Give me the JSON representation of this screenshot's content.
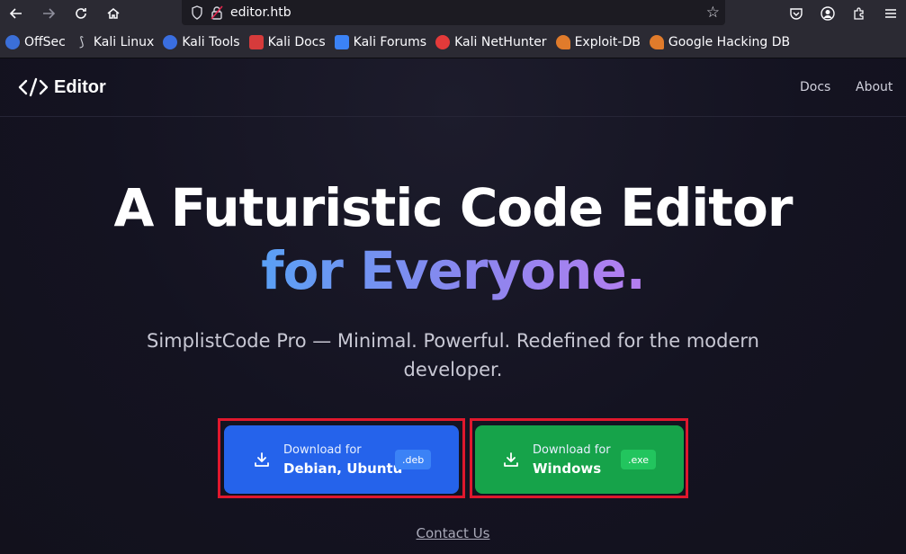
{
  "browser": {
    "url": "editor.htb",
    "bookmarks": [
      {
        "label": "OffSec",
        "icon": "offsec-icon",
        "color": "#3b6fd8"
      },
      {
        "label": "Kali Linux",
        "icon": "kali-dragon-icon",
        "color": "#9aa0aa"
      },
      {
        "label": "Kali Tools",
        "icon": "kali-tools-icon",
        "color": "#3a6ee0"
      },
      {
        "label": "Kali Docs",
        "icon": "kali-docs-icon",
        "color": "#d63b3b"
      },
      {
        "label": "Kali Forums",
        "icon": "kali-forums-icon",
        "color": "#3b82f6"
      },
      {
        "label": "Kali NetHunter",
        "icon": "nethunter-icon",
        "color": "#e43a3a"
      },
      {
        "label": "Exploit-DB",
        "icon": "exploitdb-icon",
        "color": "#e07b2b"
      },
      {
        "label": "Google Hacking DB",
        "icon": "ghdb-icon",
        "color": "#e07b2b"
      }
    ]
  },
  "nav": {
    "brand": "Editor",
    "links": [
      "Docs",
      "About"
    ]
  },
  "hero": {
    "title_line1": "A Futuristic Code Editor",
    "title_line2": "for Everyone.",
    "subtitle": "SimplistCode Pro — Minimal. Powerful. Redefined for the modern developer."
  },
  "downloads": {
    "deb": {
      "small": "Download for",
      "big": "Debian, Ubuntu",
      "badge": ".deb",
      "color": "#2563eb"
    },
    "exe": {
      "small": "Download for",
      "big": "Windows",
      "badge": ".exe",
      "color": "#16a34a"
    }
  },
  "contact": "Contact Us",
  "colors": {
    "highlight": "#e0182d",
    "page_bg": "#141420"
  }
}
